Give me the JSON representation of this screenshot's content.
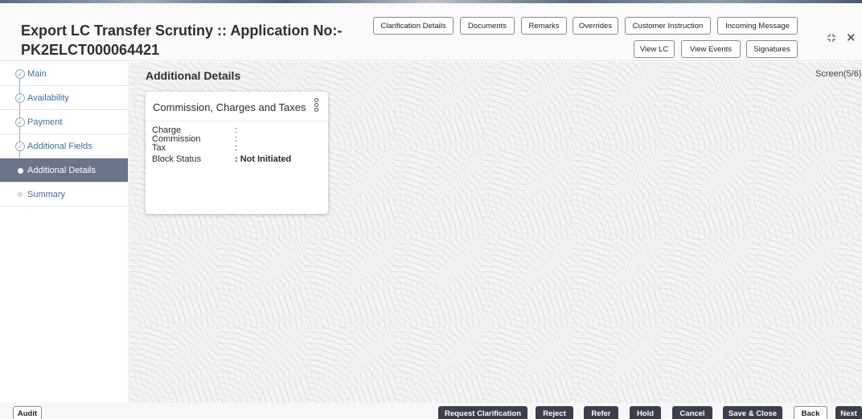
{
  "header": {
    "title_line1": "Export LC Transfer Scrutiny :: Application No:-",
    "title_line2": "PK2ELCT000064421",
    "buttons_row1": [
      "Clarification Details",
      "Documents",
      "Remarks",
      "Overrides",
      "Customer Instruction",
      "Incoming Message"
    ],
    "buttons_row2": [
      "View LC",
      "View Events",
      "Signatures"
    ],
    "icons": [
      "minimize-icon",
      "close-icon"
    ]
  },
  "sidebar": {
    "items": [
      {
        "label": "Main",
        "state": "completed"
      },
      {
        "label": "Availability",
        "state": "completed"
      },
      {
        "label": "Payment",
        "state": "completed"
      },
      {
        "label": "Additional Fields",
        "state": "completed"
      },
      {
        "label": "Additional Details",
        "state": "active"
      },
      {
        "label": "Summary",
        "state": "pending"
      }
    ]
  },
  "main": {
    "section_title": "Additional Details",
    "screen_count": "Screen(5/6)",
    "card": {
      "title": "Commission, Charges and Taxes",
      "rows": [
        {
          "label": "Charge",
          "value": ":"
        },
        {
          "label": "Commission",
          "value": ":"
        },
        {
          "label": "Tax",
          "value": ":"
        },
        {
          "label": "Block Status",
          "value": ": Not Initiated"
        }
      ]
    }
  },
  "footer": {
    "left_button": "Audit",
    "buttons": [
      "Request Clarification",
      "Reject",
      "Refer",
      "Hold",
      "Cancel",
      "Save & Close",
      "Back",
      "Next"
    ]
  },
  "colors": {
    "sidebar_active_bg": "#6b7488",
    "sidebar_link": "#3c6fa8",
    "footer_dark_button": "#3a3f4a"
  }
}
